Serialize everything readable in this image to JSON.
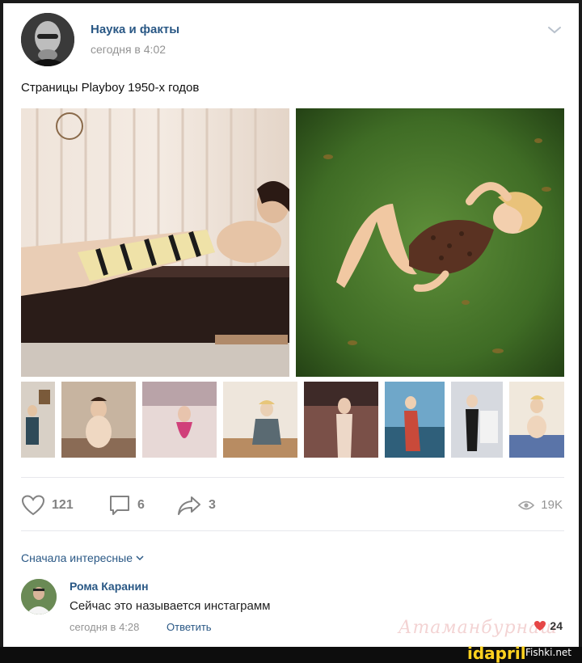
{
  "post": {
    "author": "Наука и факты",
    "date": "сегодня в 4:02",
    "text": "Страницы Playboy 1950-х годов",
    "avatar_icon": "person-portrait-icon",
    "more_icon": "chevron-down-icon"
  },
  "actions": {
    "likes": "121",
    "comments": "6",
    "shares": "3",
    "views": "19K"
  },
  "comments": {
    "sort_label": "Сначала интересные",
    "items": [
      {
        "author": "Рома Каранин",
        "text": "Сейчас это называется инстаграмм",
        "date": "сегодня в 4:28",
        "reply_label": "Ответить",
        "likes": "24"
      }
    ]
  },
  "watermarks": {
    "ida": "idapril",
    "fishki": "Fishki.net",
    "ataman": "Атаманбурнаш"
  },
  "colors": {
    "link": "#2a5885",
    "muted": "#939393",
    "icon": "#828282"
  }
}
